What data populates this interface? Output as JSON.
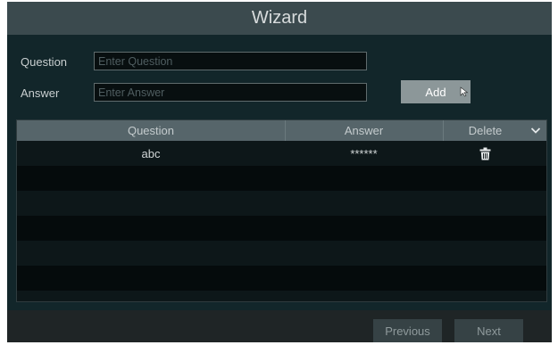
{
  "dialog": {
    "title": "Wizard"
  },
  "form": {
    "question_label": "Question",
    "question_placeholder": "Enter Question",
    "answer_label": "Answer",
    "answer_placeholder": "Enter Answer",
    "add_label": "Add"
  },
  "table": {
    "columns": [
      "Question",
      "Answer",
      "Delete"
    ],
    "rows": [
      {
        "question": "abc",
        "answer": "******",
        "delete_icon": "trash-icon"
      }
    ]
  },
  "footer": {
    "previous_label": "Previous",
    "next_label": "Next"
  },
  "colors": {
    "panel": "#12262a",
    "titlebar": "#3b4a4e",
    "table_header": "#56656a",
    "add_button": "#8c9799"
  }
}
